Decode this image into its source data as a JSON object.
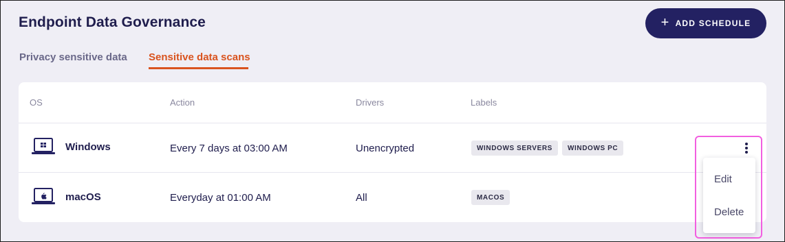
{
  "header": {
    "title": "Endpoint Data Governance",
    "add_button": "ADD SCHEDULE"
  },
  "tabs": [
    {
      "label": "Privacy sensitive data",
      "active": false
    },
    {
      "label": "Sensitive data scans",
      "active": true
    }
  ],
  "table": {
    "columns": [
      "OS",
      "Action",
      "Drivers",
      "Labels"
    ],
    "rows": [
      {
        "os": "Windows",
        "os_icon": "windows-laptop-icon",
        "action": "Every 7 days at 03:00 AM",
        "drivers": "Unencrypted",
        "labels": [
          "WINDOWS SERVERS",
          "WINDOWS PC"
        ]
      },
      {
        "os": "macOS",
        "os_icon": "apple-laptop-icon",
        "action": "Everyday at 01:00 AM",
        "drivers": "All",
        "labels": [
          "MACOS"
        ]
      }
    ]
  },
  "row_menu": {
    "items": [
      "Edit",
      "Delete"
    ]
  },
  "colors": {
    "primary": "#232162",
    "accent": "#d9531e",
    "highlight": "#f25ee0",
    "background": "#efeef5"
  }
}
